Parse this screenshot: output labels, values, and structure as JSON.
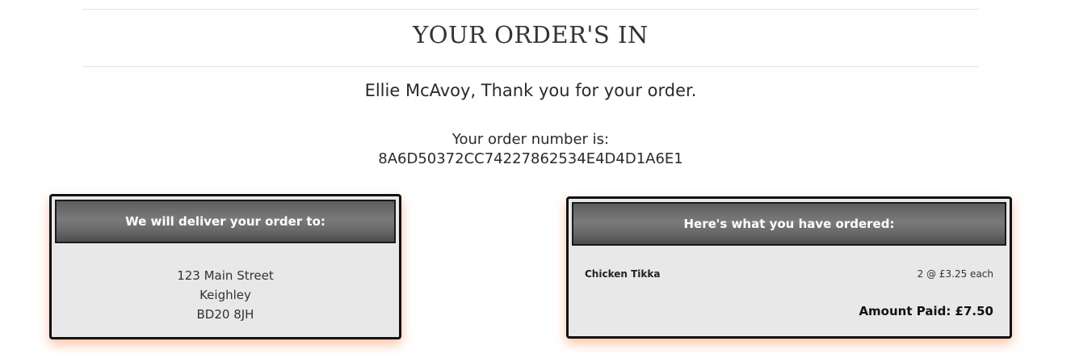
{
  "header": {
    "title": "YOUR ORDER'S IN"
  },
  "confirmation": {
    "thank_you": "Ellie McAvoy, Thank you for your order.",
    "order_number_label": "Your order number is:",
    "order_number": "8A6D50372CC74227862534E4D4D1A6E1"
  },
  "delivery": {
    "heading": "We will deliver your order to:",
    "address_lines": [
      "123 Main Street",
      "Keighley",
      "BD20 8JH"
    ]
  },
  "order_summary": {
    "heading": "Here's what you have ordered:",
    "items": [
      {
        "name": "Chicken Tikka",
        "quantity_text": "2 @ £3.25 each"
      }
    ],
    "amount_paid": "Amount Paid: £7.50"
  },
  "colors": {
    "card_background": "#e9e8e9",
    "card_header": "#6a6a6a",
    "card_glow": "#ff8c5a"
  }
}
